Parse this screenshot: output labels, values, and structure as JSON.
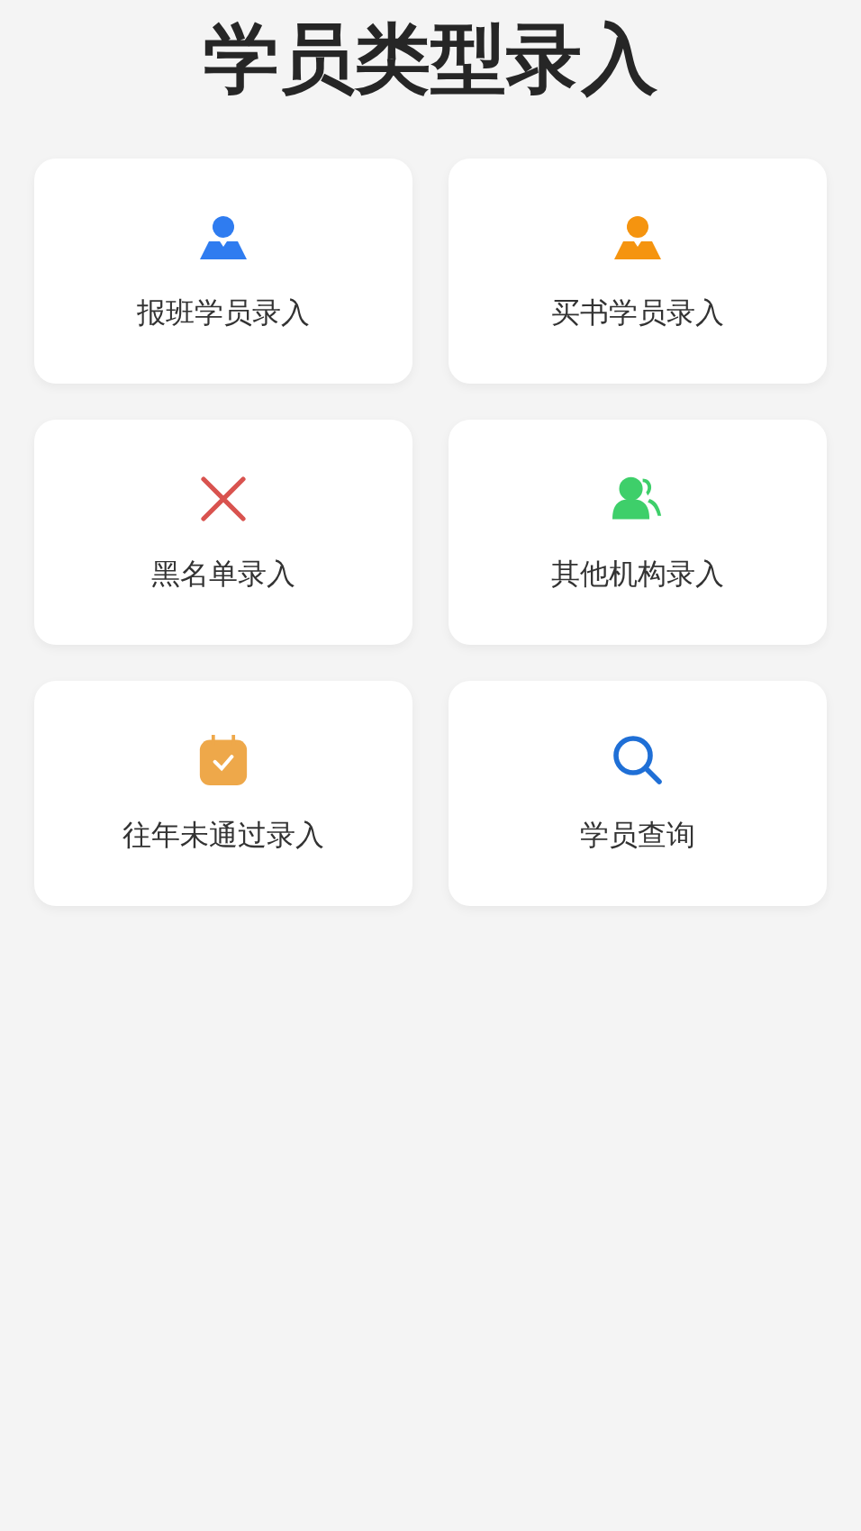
{
  "title": "学员类型录入",
  "cards": [
    {
      "label": "报班学员录入",
      "kind": "person",
      "color": "#2f7cf0"
    },
    {
      "label": "买书学员录入",
      "kind": "person",
      "color": "#f5940f"
    },
    {
      "label": "黑名单录入",
      "kind": "cross",
      "color": "#d9534f"
    },
    {
      "label": "其他机构录入",
      "kind": "group",
      "color": "#3ecf6a"
    },
    {
      "label": "往年未通过录入",
      "kind": "calendar",
      "color": "#eea84a"
    },
    {
      "label": "学员查询",
      "kind": "search",
      "color": "#1f6fd6"
    }
  ]
}
